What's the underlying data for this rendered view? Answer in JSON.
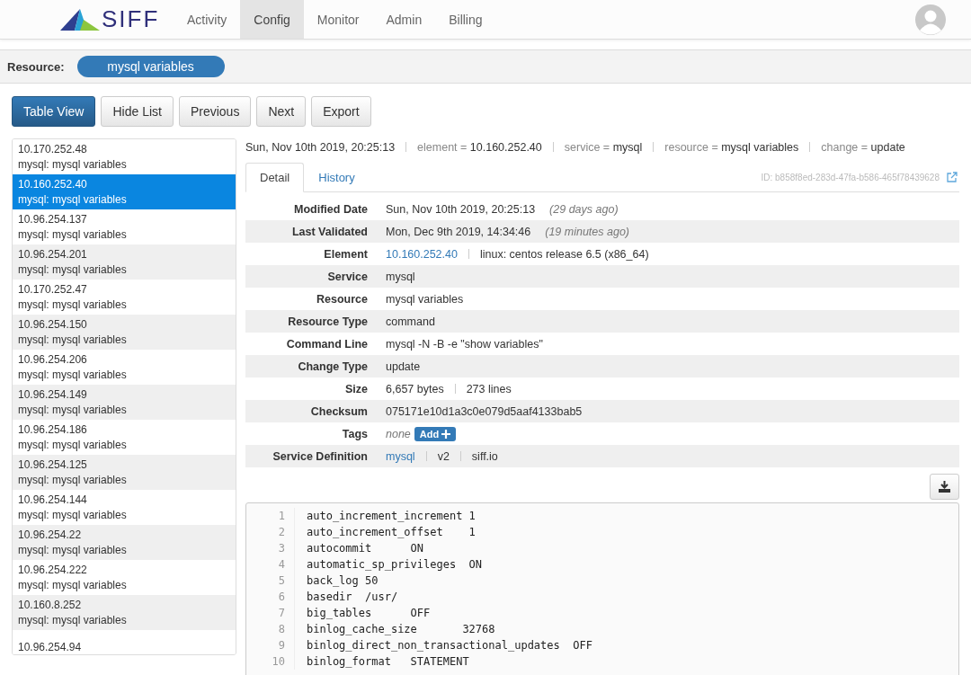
{
  "brand": "SIFF",
  "nav": [
    {
      "label": "Activity",
      "selected": false
    },
    {
      "label": "Config",
      "selected": true
    },
    {
      "label": "Monitor",
      "selected": false
    },
    {
      "label": "Admin",
      "selected": false
    },
    {
      "label": "Billing",
      "selected": false
    }
  ],
  "resource": {
    "label": "Resource:",
    "value": "mysql variables"
  },
  "toolbar": [
    {
      "label": "Table View",
      "primary": true
    },
    {
      "label": "Hide List",
      "primary": false
    },
    {
      "label": "Previous",
      "primary": false
    },
    {
      "label": "Next",
      "primary": false
    },
    {
      "label": "Export",
      "primary": false
    }
  ],
  "list": [
    {
      "title": "10.170.252.48",
      "subtitle": "mysql: mysql variables",
      "selected": false
    },
    {
      "title": "10.160.252.40",
      "subtitle": "mysql: mysql variables",
      "selected": true
    },
    {
      "title": "10.96.254.137",
      "subtitle": "mysql: mysql variables",
      "selected": false
    },
    {
      "title": "10.96.254.201",
      "subtitle": "mysql: mysql variables",
      "selected": false
    },
    {
      "title": "10.170.252.47",
      "subtitle": "mysql: mysql variables",
      "selected": false
    },
    {
      "title": "10.96.254.150",
      "subtitle": "mysql: mysql variables",
      "selected": false
    },
    {
      "title": "10.96.254.206",
      "subtitle": "mysql: mysql variables",
      "selected": false
    },
    {
      "title": "10.96.254.149",
      "subtitle": "mysql: mysql variables",
      "selected": false
    },
    {
      "title": "10.96.254.186",
      "subtitle": "mysql: mysql variables",
      "selected": false
    },
    {
      "title": "10.96.254.125",
      "subtitle": "mysql: mysql variables",
      "selected": false
    },
    {
      "title": "10.96.254.144",
      "subtitle": "mysql: mysql variables",
      "selected": false
    },
    {
      "title": "10.96.254.22",
      "subtitle": "mysql: mysql variables",
      "selected": false
    },
    {
      "title": "10.96.254.222",
      "subtitle": "mysql: mysql variables",
      "selected": false
    },
    {
      "title": "10.160.8.252",
      "subtitle": "mysql: mysql variables",
      "selected": false
    },
    {
      "title": "10.96.254.94",
      "selected": false
    }
  ],
  "summary": {
    "timestamp": "Sun, Nov 10th 2019, 20:25:13",
    "fields": [
      {
        "key": "element =",
        "value": "10.160.252.40"
      },
      {
        "key": "service =",
        "value": "mysql"
      },
      {
        "key": "resource =",
        "value": "mysql variables"
      },
      {
        "key": "change =",
        "value": "update"
      }
    ]
  },
  "tabs": [
    {
      "label": "Detail",
      "selected": true
    },
    {
      "label": "History",
      "selected": false
    }
  ],
  "record_id": "ID: b858f8ed-283d-47fa-b586-465f78439628",
  "details": [
    {
      "label": "Modified Date",
      "parts": [
        {
          "kind": "text",
          "text": "Sun, Nov 10th 2019, 20:25:13"
        },
        {
          "kind": "note",
          "text": "(29 days ago)"
        }
      ]
    },
    {
      "label": "Last Validated",
      "parts": [
        {
          "kind": "text",
          "text": "Mon, Dec 9th 2019, 14:34:46"
        },
        {
          "kind": "note",
          "text": "(19 minutes ago)"
        }
      ]
    },
    {
      "label": "Element",
      "separated": true,
      "parts": [
        {
          "kind": "link",
          "text": "10.160.252.40"
        },
        {
          "kind": "text",
          "text": "linux: centos release 6.5 (x86_64)"
        }
      ]
    },
    {
      "label": "Service",
      "parts": [
        {
          "kind": "text",
          "text": "mysql"
        }
      ]
    },
    {
      "label": "Resource",
      "parts": [
        {
          "kind": "text",
          "text": "mysql variables"
        }
      ]
    },
    {
      "label": "Resource Type",
      "parts": [
        {
          "kind": "text",
          "text": "command"
        }
      ]
    },
    {
      "label": "Command Line",
      "parts": [
        {
          "kind": "text",
          "text": "mysql -N -B -e \"show variables\""
        }
      ]
    },
    {
      "label": "Change Type",
      "parts": [
        {
          "kind": "text",
          "text": "update"
        }
      ]
    },
    {
      "label": "Size",
      "separated": true,
      "parts": [
        {
          "kind": "text",
          "text": "6,657 bytes"
        },
        {
          "kind": "text",
          "text": "273 lines"
        }
      ]
    },
    {
      "label": "Checksum",
      "parts": [
        {
          "kind": "text",
          "text": "075171e10d1a3c0e079d5aaf4133bab5"
        }
      ]
    },
    {
      "label": "Tags",
      "parts": [
        {
          "kind": "note",
          "text": "none"
        },
        {
          "kind": "add",
          "text": "Add"
        }
      ]
    },
    {
      "label": "Service Definition",
      "separated": true,
      "parts": [
        {
          "kind": "link",
          "text": "mysql"
        },
        {
          "kind": "text",
          "text": "v2"
        },
        {
          "kind": "text",
          "text": "siff.io"
        }
      ]
    }
  ],
  "code": [
    {
      "number": "1",
      "text": "auto_increment_increment 1"
    },
    {
      "number": "2",
      "text": "auto_increment_offset    1"
    },
    {
      "number": "3",
      "text": "autocommit      ON"
    },
    {
      "number": "4",
      "text": "automatic_sp_privileges  ON"
    },
    {
      "number": "5",
      "text": "back_log 50"
    },
    {
      "number": "6",
      "text": "basedir  /usr/"
    },
    {
      "number": "7",
      "text": "big_tables      OFF"
    },
    {
      "number": "8",
      "text": "binlog_cache_size       32768"
    },
    {
      "number": "9",
      "text": "binlog_direct_non_transactional_updates  OFF"
    },
    {
      "number": "10",
      "text": "binlog_format   STATEMENT"
    }
  ]
}
